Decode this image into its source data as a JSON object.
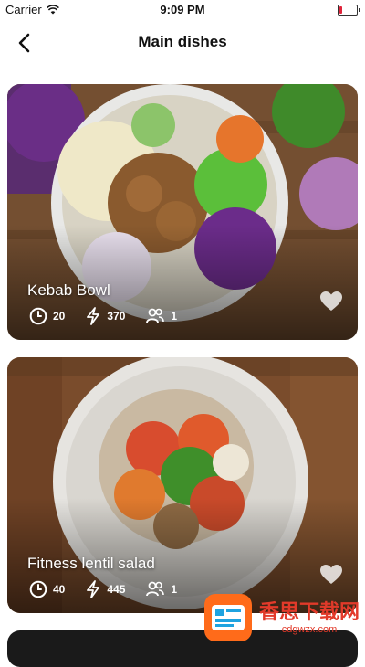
{
  "status_bar": {
    "carrier": "Carrier",
    "time": "9:09 PM",
    "battery_level": 0.15
  },
  "nav": {
    "title": "Main dishes",
    "back_icon": "chevron-left-icon"
  },
  "recipes": [
    {
      "name": "Kebab Bowl",
      "time": "20",
      "calories": "370",
      "servings": "1"
    },
    {
      "name": "Fitness lentil salad",
      "time": "40",
      "calories": "445",
      "servings": "1"
    }
  ],
  "icons": {
    "time": "clock-icon",
    "calories": "lightning-icon",
    "servings": "users-icon",
    "favorite": "heart-icon"
  },
  "watermark": {
    "cn_text": "香思下载网",
    "url": "cdgwzx.com"
  },
  "colors": {
    "accent_battery": "#e0243a",
    "watermark": "#e23a2a"
  }
}
